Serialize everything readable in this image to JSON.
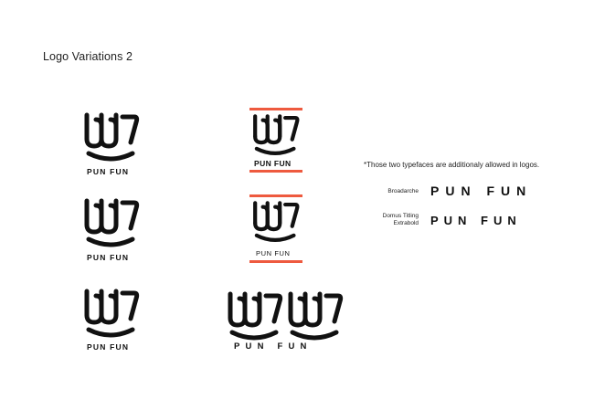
{
  "page": {
    "title": "Logo Variations 2"
  },
  "brand": {
    "wordmark": "PUN FUN",
    "logo_icon": "hand-smile-icon",
    "colors": {
      "ink": "#111111",
      "accent": "#ee5a3f",
      "background": "#ffffff"
    }
  },
  "variations": [
    {
      "label": "PUN FUN"
    },
    {
      "label": "PUN FUN"
    },
    {
      "label": "PUN FUN"
    },
    {
      "label": "PUN FUN"
    },
    {
      "label": "PUN FUN"
    },
    {
      "label": "PUN FUN"
    }
  ],
  "typefaces": {
    "note": "*Those two typefaces are additionaly allowed in logos.",
    "items": [
      {
        "name": "Broadarche",
        "sample": "PUN FUN"
      },
      {
        "name_line1": "Domus Titling",
        "name_line2": "Extrabold",
        "sample": "PUN FUN"
      }
    ]
  }
}
